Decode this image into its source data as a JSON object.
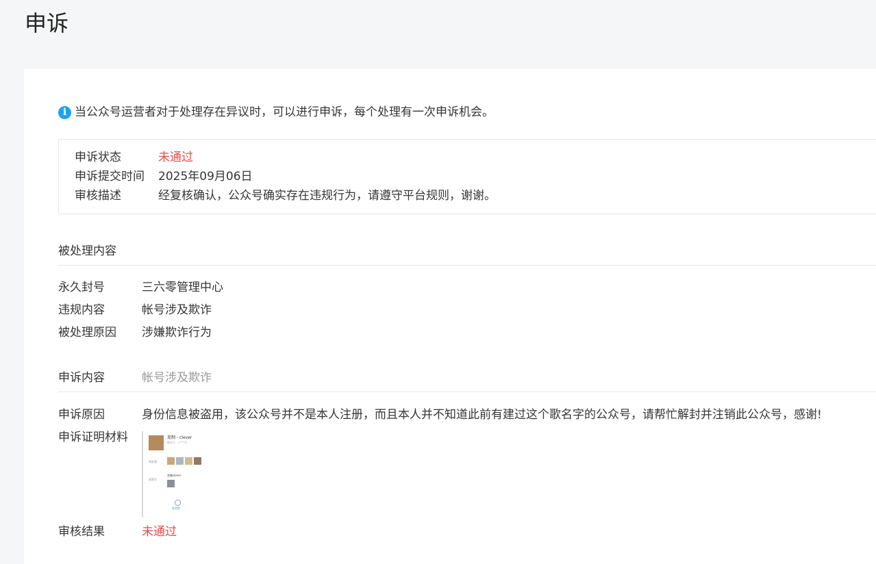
{
  "page": {
    "title": "申诉"
  },
  "notice": {
    "text": "当公众号运营者对于处理存在异议时，可以进行申诉，每个处理有一次申诉机会。"
  },
  "status": {
    "state_label": "申诉状态",
    "state_value": "未通过",
    "submit_label": "申诉提交时间",
    "submit_value": "2025年09月06日",
    "review_label": "审核描述",
    "review_value": "经复核确认，公众号确实存在违规行为，请遵守平台规则，谢谢。"
  },
  "processed": {
    "section_title": "被处理内容",
    "rows": [
      {
        "label": "永久封号",
        "value": "三六零管理中心"
      },
      {
        "label": "违规内容",
        "value": "帐号涉及欺诈"
      },
      {
        "label": "被处理原因",
        "value": "涉嫌欺诈行为"
      }
    ]
  },
  "appeal": {
    "content_label": "申诉内容",
    "content_value": "帐号涉及欺诈",
    "reason_label": "申诉原因",
    "reason_value": "身份信息被盗用，该公众号并不是本人注册，而且本人并不知道此前有建过这个歌名字的公众号，请帮忙解封并注销此公众号，感谢!",
    "proof_label": "申诉证明材料",
    "result_label": "审核结果",
    "result_value": "未通过"
  },
  "evidence_image": {
    "name": "克制 - clever",
    "meta_line": "微信号：c****2",
    "label_1": "朋友圈",
    "label_2": "视频号",
    "video_name": "克制clever",
    "link_text": "发消息"
  },
  "colors": {
    "accent": "#1aa3f0",
    "fail": "#e84a4a",
    "divider": "#e4e6e9"
  }
}
